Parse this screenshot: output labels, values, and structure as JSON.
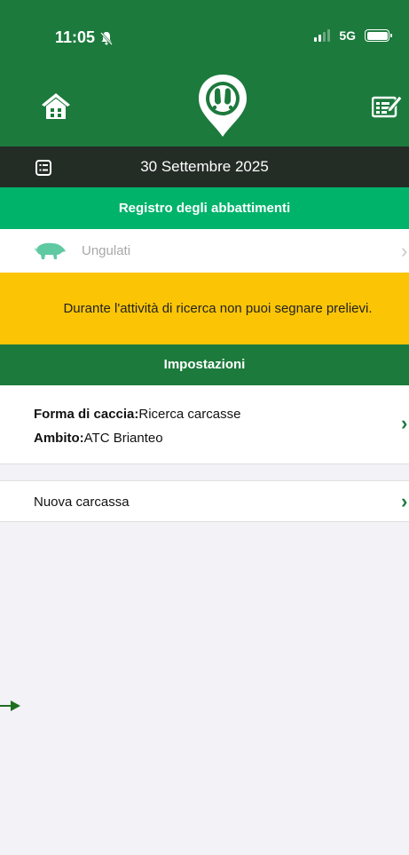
{
  "status_bar": {
    "time": "11:05",
    "network": "5G"
  },
  "header": {
    "home_icon": "home-icon",
    "logo_icon": "hoofprint-pin-icon",
    "register_icon": "register-edit-icon"
  },
  "date_bar": {
    "date": "30 Settembre 2025",
    "icon": "calendar-list-icon"
  },
  "registro": {
    "title": "Registro degli abbattimenti"
  },
  "ungulati": {
    "label": "Ungulati",
    "icon": "boar-icon"
  },
  "warning": {
    "text": "Durante l'attività di ricerca non puoi segnare prelievi."
  },
  "impostazioni": {
    "title": "Impostazioni",
    "forma_label": "Forma di caccia:",
    "forma_value": "Ricerca carcasse",
    "ambito_label": "Ambito:",
    "ambito_value": "ATC Brianteo"
  },
  "nuova": {
    "label": "Nuova carcassa"
  },
  "colors": {
    "dark_green": "#1c7a3c",
    "bright_green": "#00b36b",
    "warning_yellow": "#fbc506",
    "dark_bar": "#242c26"
  }
}
